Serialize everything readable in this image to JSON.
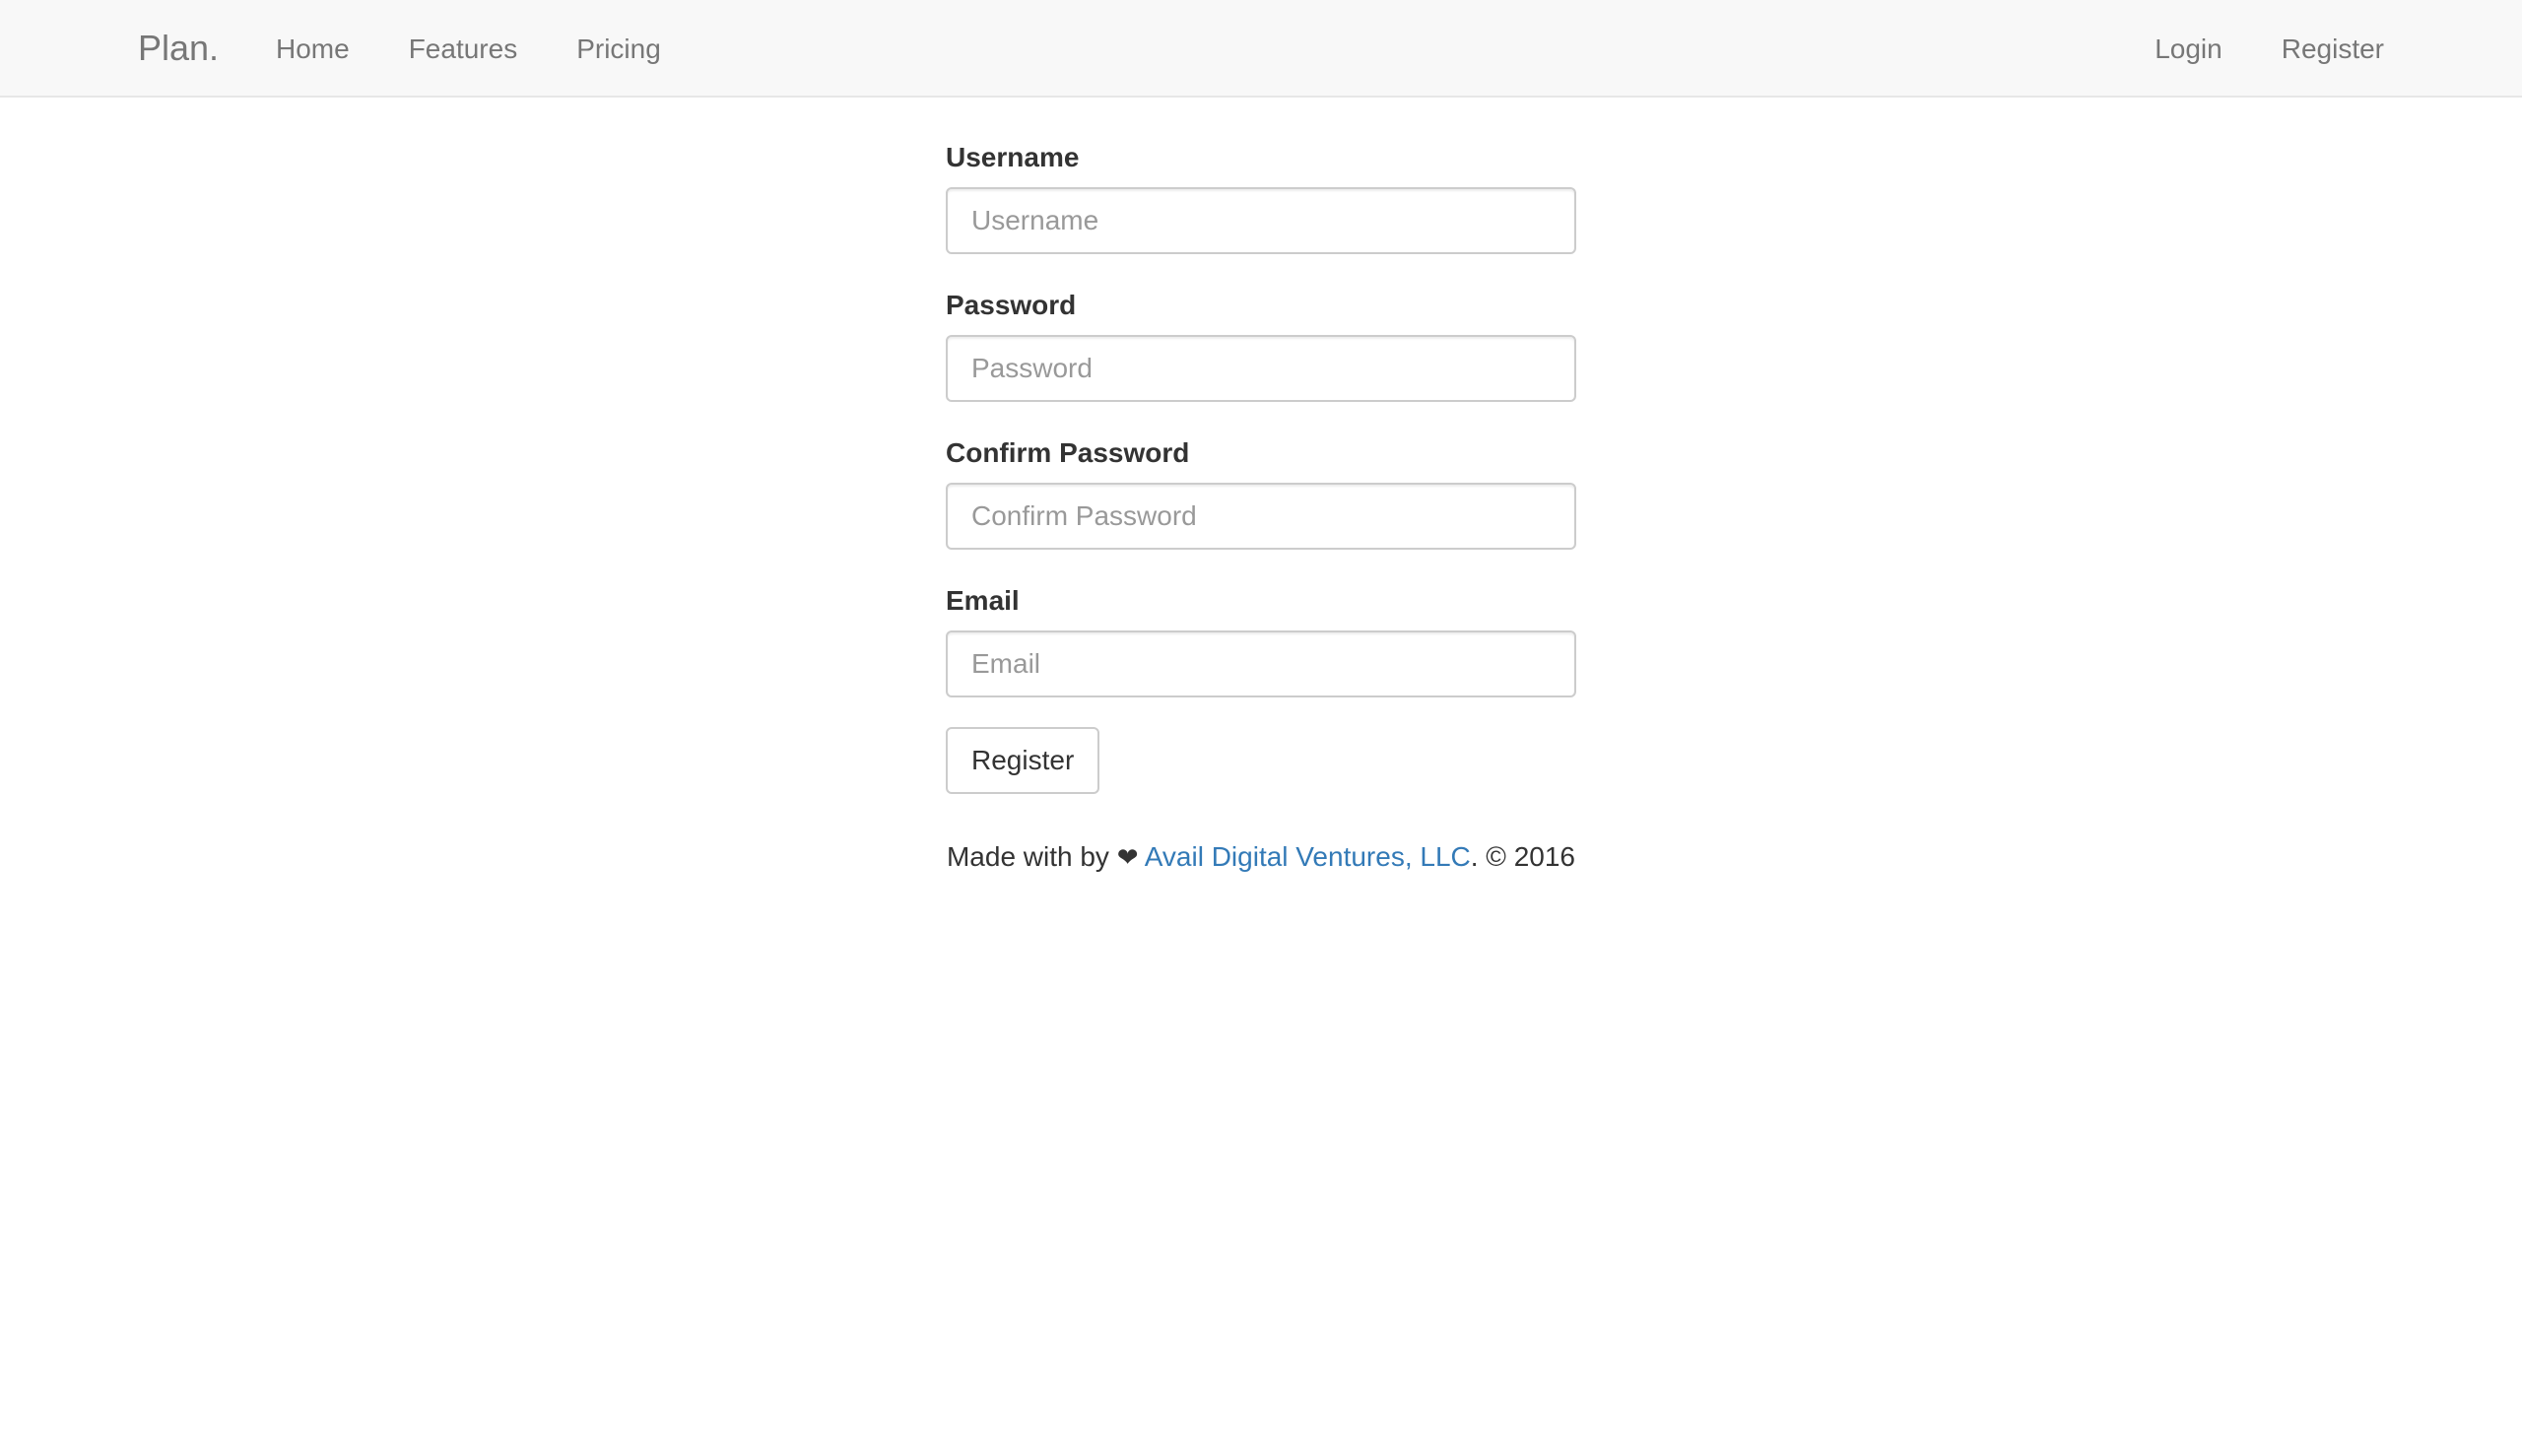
{
  "navbar": {
    "brand": "Plan.",
    "left_links": [
      {
        "label": "Home"
      },
      {
        "label": "Features"
      },
      {
        "label": "Pricing"
      }
    ],
    "right_links": [
      {
        "label": "Login"
      },
      {
        "label": "Register"
      }
    ]
  },
  "form": {
    "fields": [
      {
        "label": "Username",
        "placeholder": "Username",
        "value": ""
      },
      {
        "label": "Password",
        "placeholder": "Password",
        "value": ""
      },
      {
        "label": "Confirm Password",
        "placeholder": "Confirm Password",
        "value": ""
      },
      {
        "label": "Email",
        "placeholder": "Email",
        "value": ""
      }
    ],
    "submit_label": "Register"
  },
  "footer": {
    "prefix": "Made with by",
    "heart_icon": "heart-icon",
    "heart_glyph": "❤",
    "link_text": "Avail Digital Ventures, LLC",
    "suffix": ". © 2016"
  },
  "colors": {
    "navbar_bg": "#f8f8f8",
    "link": "#337ab7",
    "nav_text": "#777777"
  }
}
